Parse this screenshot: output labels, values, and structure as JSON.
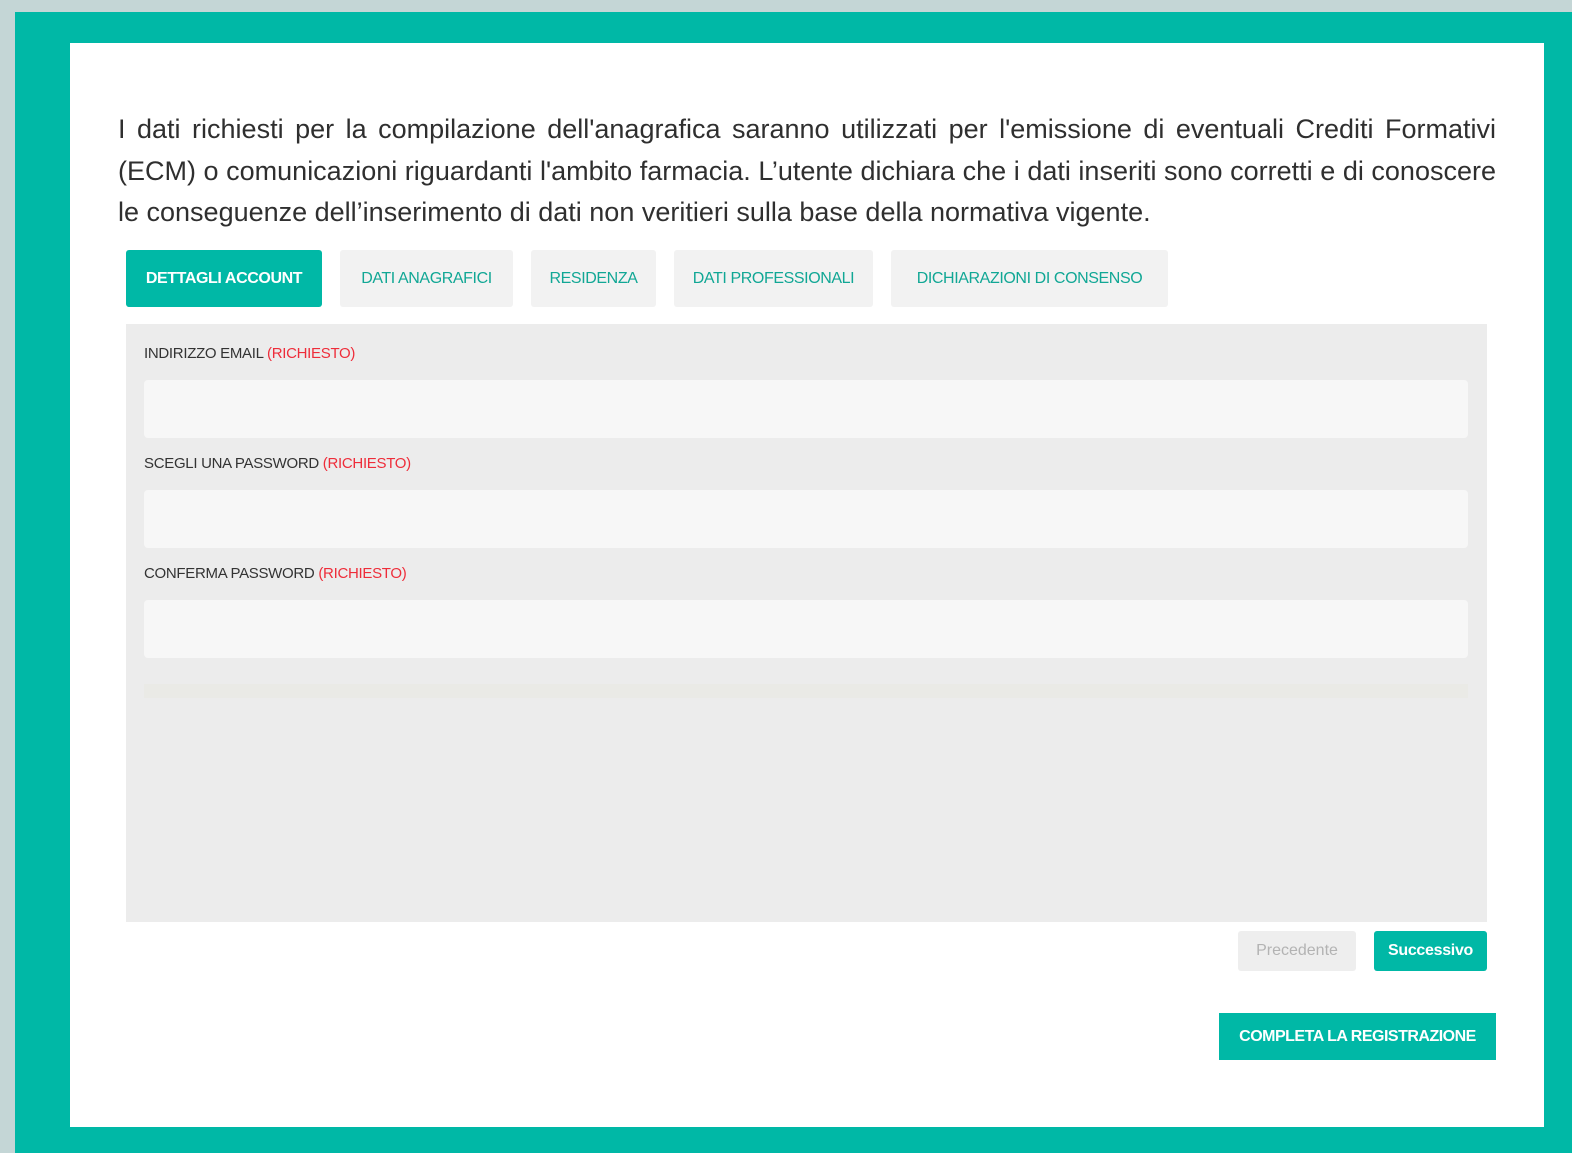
{
  "intro_text": "I dati richiesti per la compilazione dell'anagrafica saranno utilizzati per l'emissione di eventuali Crediti Formativi (ECM) o comunicazioni riguardanti l'ambito farmacia. L’utente dichiara che i dati inseriti sono corretti e di conoscere le conseguenze dell’inserimento di dati non veritieri sulla base della normativa vigente.",
  "tabs": [
    {
      "label": "DETTAGLI ACCOUNT",
      "active": true
    },
    {
      "label": "DATI ANAGRAFICI",
      "active": false
    },
    {
      "label": "RESIDENZA",
      "active": false
    },
    {
      "label": "DATI PROFESSIONALI",
      "active": false
    },
    {
      "label": "DICHIARAZIONI DI CONSENSO",
      "active": false
    }
  ],
  "form": {
    "email": {
      "label": "INDIRIZZO EMAIL",
      "required": "(RICHIESTO)",
      "value": ""
    },
    "password": {
      "label": "SCEGLI UNA PASSWORD",
      "required": "(RICHIESTO)",
      "value": ""
    },
    "confirm_password": {
      "label": "CONFERMA PASSWORD",
      "required": "(RICHIESTO)",
      "value": ""
    }
  },
  "buttons": {
    "prev": "Precedente",
    "next": "Successivo",
    "complete": "COMPLETA LA REGISTRAZIONE"
  },
  "colors": {
    "accent": "#00b8a6",
    "required": "#ee2d3a",
    "background": "#c4d6d6"
  }
}
